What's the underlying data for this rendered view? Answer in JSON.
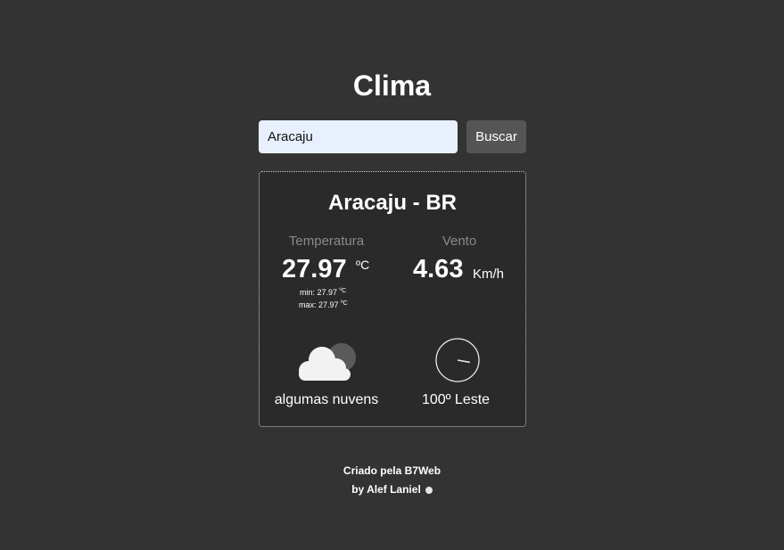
{
  "app": {
    "title": "Clima"
  },
  "search": {
    "value": "Aracaju",
    "button_label": "Buscar"
  },
  "result": {
    "location": "Aracaju - BR",
    "temperature": {
      "label": "Temperatura",
      "value": "27.97",
      "unit": "ºC",
      "min_label": "min: 27.97",
      "min_unit": "ºC",
      "max_label": "max: 27.97",
      "max_unit": "ºC"
    },
    "wind": {
      "label": "Vento",
      "value": "4.63",
      "unit": "Km/h",
      "direction_degrees": 100,
      "direction_text": "100º Leste"
    },
    "condition": {
      "icon": "cloud-icon",
      "description": "algumas nuvens"
    }
  },
  "footer": {
    "line1": "Criado pela B7Web",
    "line2": "by Alef Laniel",
    "icon": "heart-icon"
  },
  "colors": {
    "background": "#333333",
    "card_background": "#2a2a2a",
    "input_background": "#e8f0fe",
    "button_background": "#555555",
    "muted_label": "#8a8a8a"
  }
}
